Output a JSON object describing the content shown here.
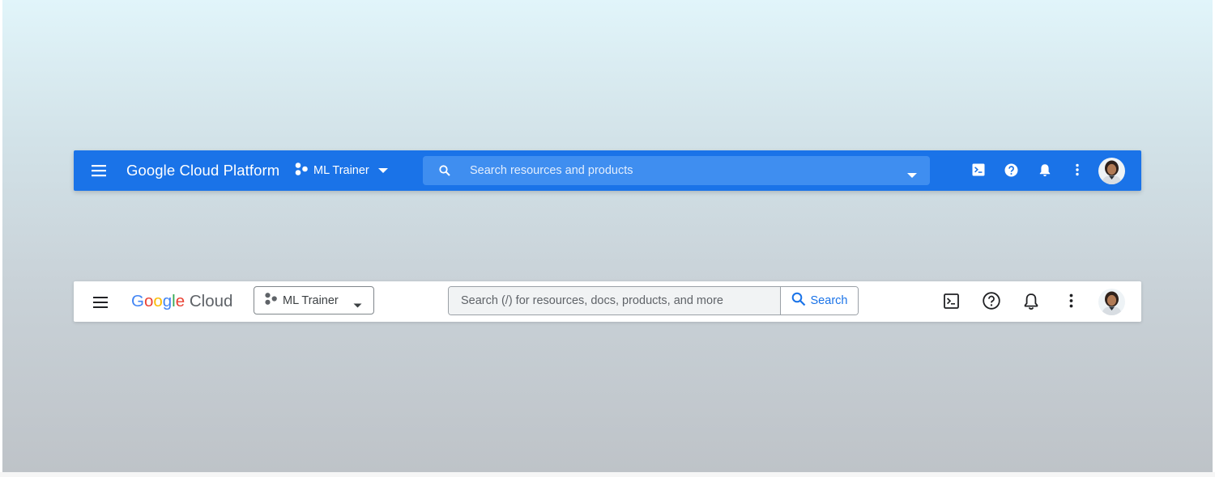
{
  "old_header": {
    "brand": "Google Cloud Platform",
    "project": "ML Trainer",
    "search_placeholder": "Search resources and products",
    "colors": {
      "bar": "#1a73e8",
      "search_bg": "#3f8ef0",
      "text": "#ffffff"
    },
    "icons": [
      "menu-icon",
      "project-nodes-icon",
      "dropdown-caret-icon",
      "search-icon",
      "cloud-shell-icon",
      "help-icon",
      "notifications-icon",
      "more-vert-icon",
      "avatar"
    ]
  },
  "new_header": {
    "brand_letters": [
      "G",
      "o",
      "o",
      "g",
      "l",
      "e"
    ],
    "brand_suffix": "Cloud",
    "project": "ML Trainer",
    "search_placeholder": "Search (/) for resources, docs, products, and more",
    "search_button": "Search",
    "colors": {
      "bar": "#ffffff",
      "accent": "#1a73e8",
      "search_field_bg": "#f1f3f4",
      "icon": "#202124"
    },
    "icons": [
      "menu-icon",
      "project-nodes-icon",
      "dropdown-caret-icon",
      "search-icon",
      "cloud-shell-icon",
      "help-icon",
      "notifications-icon",
      "more-vert-icon",
      "avatar"
    ]
  }
}
